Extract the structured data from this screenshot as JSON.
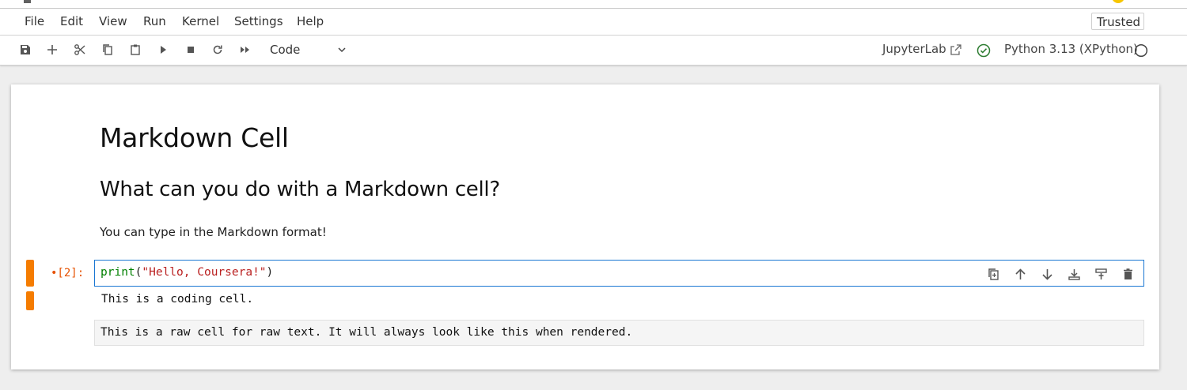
{
  "menubar": {
    "items": [
      "File",
      "Edit",
      "View",
      "Run",
      "Kernel",
      "Settings",
      "Help"
    ],
    "trusted_label": "Trusted"
  },
  "toolbar": {
    "buttons": [
      "save-icon",
      "add-cell-icon",
      "cut-icon",
      "copy-icon",
      "paste-icon",
      "run-icon",
      "stop-icon",
      "restart-icon",
      "run-all-icon"
    ],
    "cell_type": "Code",
    "open_in": "JupyterLab",
    "kernel_name": "Python 3.13 (XPython)"
  },
  "notebook": {
    "markdown": {
      "h1": "Markdown Cell",
      "h2": "What can you do with a Markdown cell?",
      "paragraph": "You can type in the Markdown format!"
    },
    "code_cell": {
      "prompt": "•[2]:",
      "code_fn": "print",
      "code_open": "(",
      "code_string": "\"Hello, Coursera!\"",
      "code_close": ")",
      "output": "This is a coding cell.",
      "tools": [
        "duplicate-icon",
        "move-up-icon",
        "move-down-icon",
        "insert-above-icon",
        "insert-below-icon",
        "delete-icon"
      ]
    },
    "raw_cell": {
      "text": "This is a raw cell for raw text. It will always look like this when rendered."
    }
  },
  "colors": {
    "accent": "#1976d2",
    "prompt": "#e65100",
    "collapser": "#f57c00",
    "kernel_ok": "#2e7d32"
  }
}
